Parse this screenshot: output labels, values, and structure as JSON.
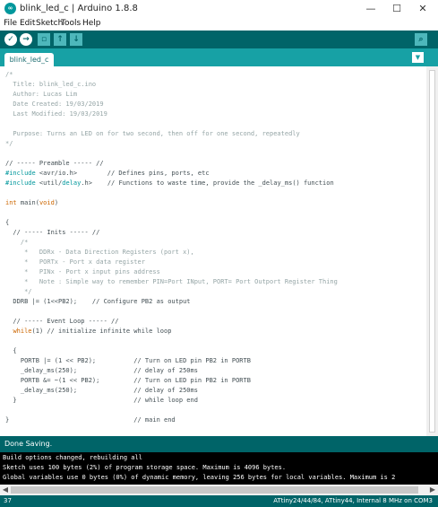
{
  "window": {
    "title": "blink_led_c | Arduino 1.8.8",
    "icon": "arduino-icon"
  },
  "menu": [
    "File",
    "Edit",
    "Sketch",
    "Tools",
    "Help"
  ],
  "tab": {
    "label": "blink_led_c"
  },
  "colors": {
    "toolbar": "#006468",
    "tabbar": "#17a1a5",
    "comment": "#95a5a6",
    "keyword": "#00979c",
    "type": "#cc6600",
    "text": "#434f54"
  },
  "code_lines": [
    [
      {
        "t": "/*",
        "c": "cm"
      }
    ],
    [
      {
        "t": "  Title: blink_led_c.ino",
        "c": "cm"
      }
    ],
    [
      {
        "t": "  Author: Lucas Lim",
        "c": "cm"
      }
    ],
    [
      {
        "t": "  Date Created: 19/03/2019",
        "c": "cm"
      }
    ],
    [
      {
        "t": "  Last Modified: 19/03/2019",
        "c": "cm"
      }
    ],
    [
      {
        "t": "",
        "c": "tx"
      }
    ],
    [
      {
        "t": "  Purpose: Turns an LED on for two second, then off for one second, repeatedly",
        "c": "cm"
      }
    ],
    [
      {
        "t": "*/",
        "c": "cm"
      }
    ],
    [
      {
        "t": "",
        "c": "tx"
      }
    ],
    [
      {
        "t": "// ----- Preamble ----- //",
        "c": "tx"
      }
    ],
    [
      {
        "t": "#include",
        "c": "kw"
      },
      {
        "t": " <avr/io.h>        // Defines pins, ports, etc",
        "c": "tx"
      }
    ],
    [
      {
        "t": "#include",
        "c": "kw"
      },
      {
        "t": " <util/",
        "c": "tx"
      },
      {
        "t": "delay",
        "c": "kw"
      },
      {
        "t": ".h>    // Functions to waste time, provide the _delay_ms() function",
        "c": "tx"
      }
    ],
    [
      {
        "t": "",
        "c": "tx"
      }
    ],
    [
      {
        "t": "int",
        "c": "ty"
      },
      {
        "t": " main(",
        "c": "tx"
      },
      {
        "t": "void",
        "c": "ty"
      },
      {
        "t": ")",
        "c": "tx"
      }
    ],
    [
      {
        "t": "",
        "c": "tx"
      }
    ],
    [
      {
        "t": "{",
        "c": "tx"
      }
    ],
    [
      {
        "t": "  // ----- Inits ----- //",
        "c": "tx"
      }
    ],
    [
      {
        "t": "    /*",
        "c": "cm"
      }
    ],
    [
      {
        "t": "     *   DDRx - Data Direction Registers (port x),",
        "c": "cm"
      }
    ],
    [
      {
        "t": "     *   PORTx - Port x data register",
        "c": "cm"
      }
    ],
    [
      {
        "t": "     *   PINx - Port x input pins address",
        "c": "cm"
      }
    ],
    [
      {
        "t": "     *   Note : Simple way to remember PIN=Port INput, PORT= Port Outport Register Thing",
        "c": "cm"
      }
    ],
    [
      {
        "t": "     */",
        "c": "cm"
      }
    ],
    [
      {
        "t": "  DDRB |= (1<<PB2);    // Configure PB2 as output",
        "c": "tx"
      }
    ],
    [
      {
        "t": "",
        "c": "tx"
      }
    ],
    [
      {
        "t": "  // ----- Event Loop ----- //",
        "c": "tx"
      }
    ],
    [
      {
        "t": "  ",
        "c": "tx"
      },
      {
        "t": "while",
        "c": "ty"
      },
      {
        "t": "(1) // initialize infinite while loop",
        "c": "tx"
      }
    ],
    [
      {
        "t": "",
        "c": "tx"
      }
    ],
    [
      {
        "t": "  {",
        "c": "tx"
      }
    ],
    [
      {
        "t": "    PORTB |= (1 << PB2);          // Turn on LED pin PB2 in PORTB",
        "c": "tx"
      }
    ],
    [
      {
        "t": "    _delay_ms(250);               // delay of 250ms",
        "c": "tx"
      }
    ],
    [
      {
        "t": "    PORTB &= ~(1 << PB2);         // Turn on LED pin PB2 in PORTB",
        "c": "tx"
      }
    ],
    [
      {
        "t": "    _delay_ms(250);               // delay of 250ms",
        "c": "tx"
      }
    ],
    [
      {
        "t": "  }                               // while loop end",
        "c": "tx"
      }
    ],
    [
      {
        "t": "",
        "c": "tx"
      }
    ],
    [
      {
        "t": "}                                 // main end",
        "c": "tx"
      }
    ]
  ],
  "status": {
    "message": "Done Saving."
  },
  "console": [
    {
      "t": "Build options changed, rebuilding all",
      "c": "w"
    },
    {
      "t": "Sketch uses 100 bytes (2%) of program storage space. Maximum is 4096 bytes.",
      "c": "w"
    },
    {
      "t": "Global variables use 0 bytes (0%) of dynamic memory, leaving 256 bytes for local variables. Maximum is 2",
      "c": "w"
    }
  ],
  "footer": {
    "line": "37",
    "board": "ATtiny24/44/84, ATtiny44, Internal 8 MHz on COM3"
  }
}
